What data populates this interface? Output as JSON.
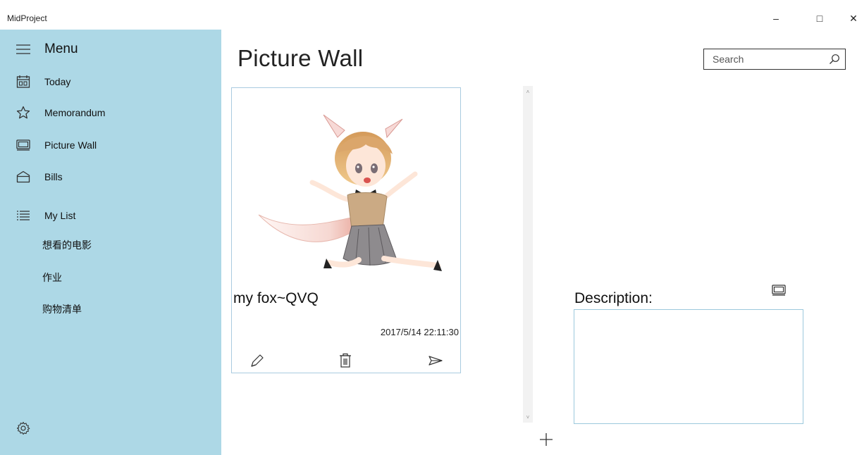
{
  "window": {
    "title": "MidProject",
    "minimize_glyph": "–",
    "maximize_glyph": "□",
    "close_glyph": "✕"
  },
  "sidebar": {
    "menu_label": "Menu",
    "items": [
      {
        "label": "Today",
        "icon": "calendar-icon"
      },
      {
        "label": "Memorandum",
        "icon": "star-icon"
      },
      {
        "label": "Picture Wall",
        "icon": "picture-icon"
      },
      {
        "label": "Bills",
        "icon": "envelope-icon"
      },
      {
        "label": "My List",
        "icon": "list-icon"
      }
    ],
    "lists": [
      "想看的电影",
      "作业",
      "购物清单"
    ],
    "settings_icon": "gear-icon",
    "background": "#add8e6"
  },
  "header": {
    "page_title": "Picture Wall",
    "search_placeholder": "Search"
  },
  "card": {
    "title": "my fox~QVQ",
    "date": "2017/5/14 22:11:30",
    "actions": [
      "edit-icon",
      "delete-icon",
      "share-icon"
    ],
    "border_color": "#a9cbe0"
  },
  "detail": {
    "description_label": "Description:",
    "description_value": ""
  },
  "add_button_icon": "plus-icon"
}
